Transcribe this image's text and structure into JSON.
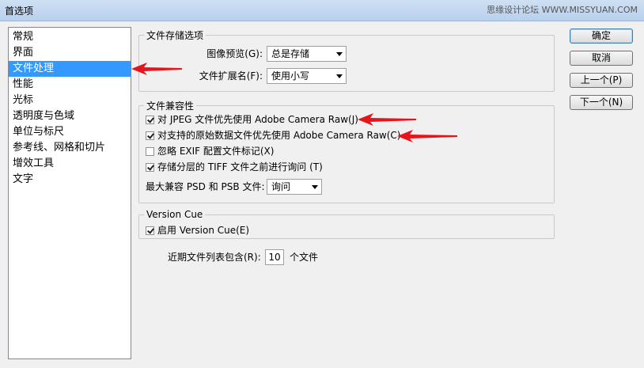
{
  "window": {
    "title": "首选项",
    "watermark": "思缘设计论坛 WWW.MISSYUAN.COM"
  },
  "sidebar": {
    "items": [
      {
        "label": "常规"
      },
      {
        "label": "界面"
      },
      {
        "label": "文件处理",
        "selected": true
      },
      {
        "label": "性能"
      },
      {
        "label": "光标"
      },
      {
        "label": "透明度与色域"
      },
      {
        "label": "单位与标尺"
      },
      {
        "label": "参考线、网格和切片"
      },
      {
        "label": "增效工具"
      },
      {
        "label": "文字"
      }
    ]
  },
  "file_saving": {
    "legend": "文件存储选项",
    "image_preview_label": "图像预览(G):",
    "image_preview_value": "总是存储",
    "extension_label": "文件扩展名(F):",
    "extension_value": "使用小写"
  },
  "compatibility": {
    "legend": "文件兼容性",
    "options": [
      {
        "label": "对 JPEG 文件优先使用 Adobe Camera Raw(J)",
        "checked": true
      },
      {
        "label": "对支持的原始数据文件优先使用 Adobe Camera Raw(C)",
        "checked": true
      },
      {
        "label": "忽略 EXIF 配置文件标记(X)",
        "checked": false
      },
      {
        "label": "存储分层的 TIFF 文件之前进行询问 (T)",
        "checked": true
      }
    ],
    "max_compat_label": "最大兼容 PSD 和 PSB 文件:",
    "max_compat_value": "询问"
  },
  "version_cue": {
    "legend": "Version Cue",
    "enable_label": "启用 Version Cue(E)",
    "enabled": true
  },
  "recent_files": {
    "label": "近期文件列表包含(R):",
    "value": "10",
    "suffix": "个文件"
  },
  "buttons": {
    "ok": "确定",
    "cancel": "取消",
    "prev": "上一个(P)",
    "next": "下一个(N)"
  },
  "colors": {
    "selection": "#3399ff",
    "annotation_arrow": "#e8141b"
  }
}
